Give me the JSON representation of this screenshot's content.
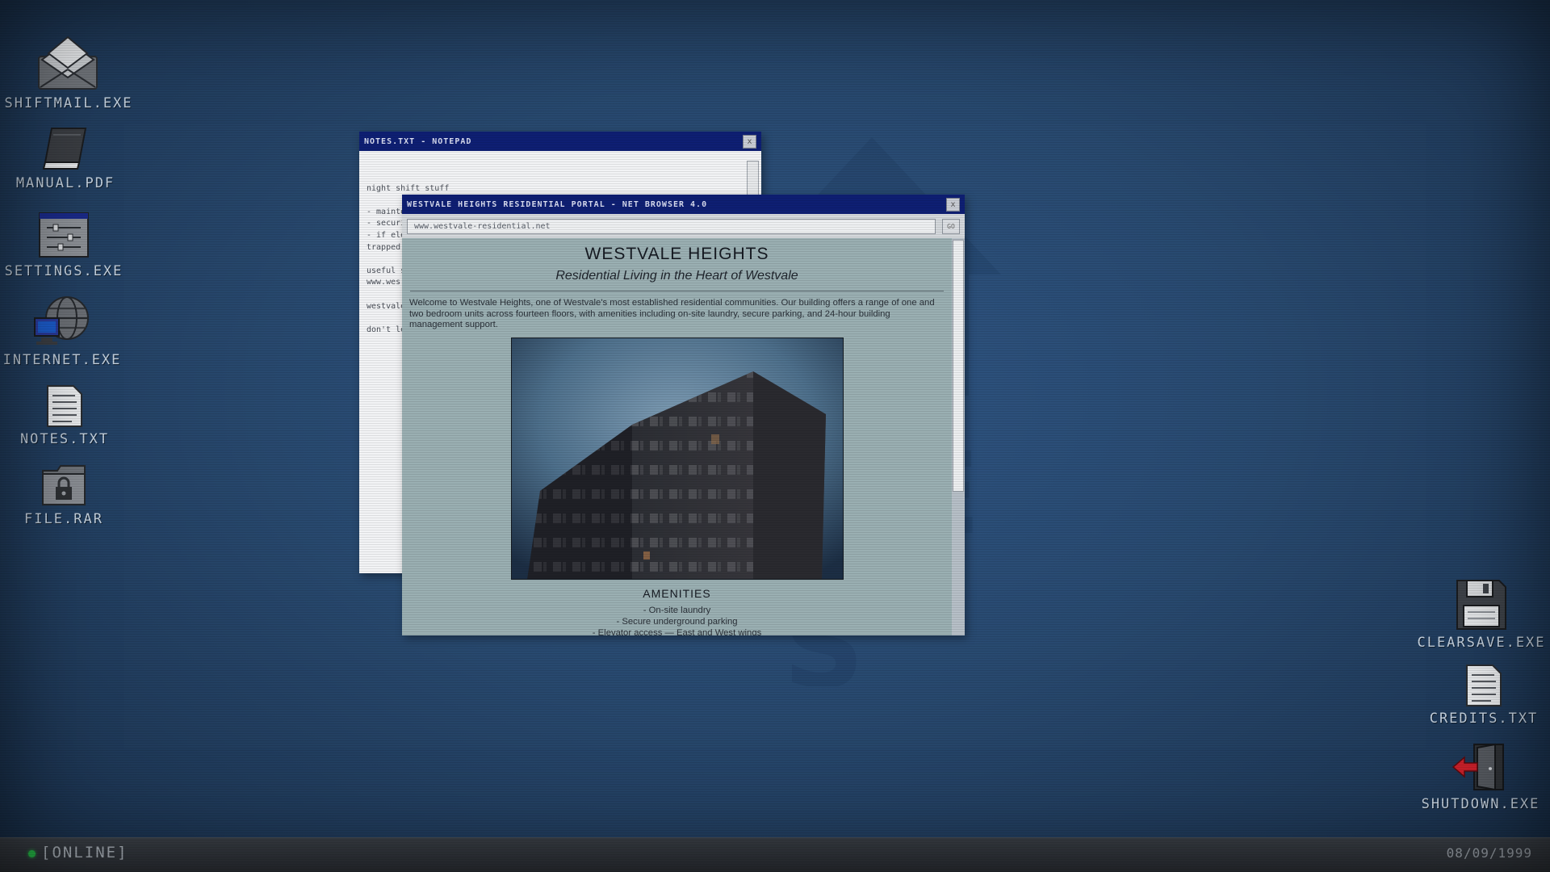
{
  "desktop": {
    "left_icons": [
      {
        "label": "SHIFTMAIL.EXE",
        "icon": "mail-icon"
      },
      {
        "label": "MANUAL.PDF",
        "icon": "book-icon"
      },
      {
        "label": "SETTINGS.EXE",
        "icon": "settings-icon"
      },
      {
        "label": "INTERNET.EXE",
        "icon": "globe-computer-icon"
      },
      {
        "label": "NOTES.TXT",
        "icon": "document-icon"
      },
      {
        "label": "FILE.RAR",
        "icon": "locked-folder-icon"
      }
    ],
    "right_icons": [
      {
        "label": "CLEARSAVE.EXE",
        "icon": "floppy-disk-icon"
      },
      {
        "label": "CREDITS.TXT",
        "icon": "document-icon"
      },
      {
        "label": "SHUTDOWN.EXE",
        "icon": "exit-door-icon"
      }
    ]
  },
  "notepad": {
    "title": "NOTES.TXT - NOTEPAD",
    "close_label": "x",
    "lines": [
      "night shift stuff",
      "",
      "- mainte",
      "- securi",
      "- if elev",
      "trapped",
      "",
      "useful s",
      "www.wes",
      "",
      "westvale",
      "",
      "don't le"
    ]
  },
  "browser": {
    "title": "WESTVALE HEIGHTS RESIDENTIAL PORTAL - NET BROWSER 4.0",
    "close_label": "x",
    "url": "www.westvale-residential.net",
    "go_label": "GO",
    "page": {
      "heading": "WESTVALE HEIGHTS",
      "tagline": "Residential Living in the Heart of Westvale",
      "intro": "Welcome to Westvale Heights, one of Westvale's most established residential communities. Our building offers a range of one and two bedroom units across fourteen floors, with amenities including on-site laundry, secure parking, and 24-hour building management support.",
      "amenities_heading": "AMENITIES",
      "amenities": [
        "- On-site laundry",
        "- Secure underground parking",
        "- Elevator access — East and West wings"
      ]
    }
  },
  "taskbar": {
    "status": "[ONLINE]",
    "status_color": "#27c24a",
    "date": "08/09/1999"
  },
  "colors": {
    "desktop_bg": "#28496f",
    "titlebar": "#0e1f73",
    "browser_page_bg": "#9aafb2"
  }
}
